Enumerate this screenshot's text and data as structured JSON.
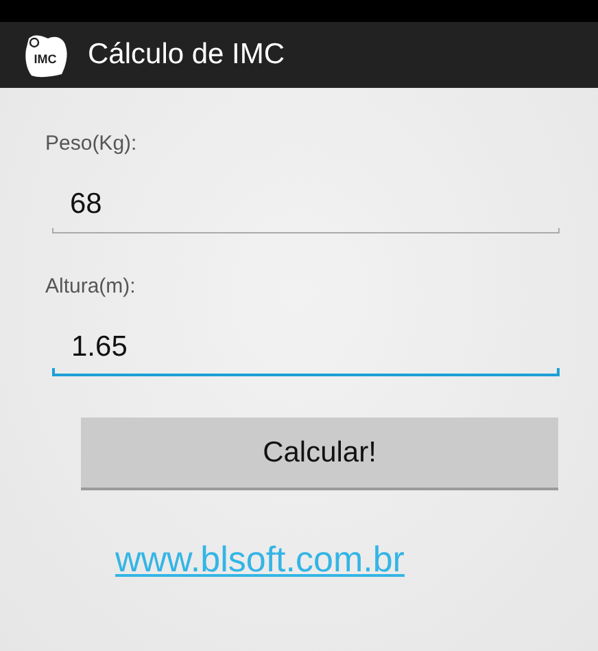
{
  "action_bar": {
    "icon_label": "IMC",
    "title": "Cálculo de IMC"
  },
  "fields": [
    {
      "label": "Peso(Kg):",
      "value": "68",
      "focused": false
    },
    {
      "label": "Altura(m):",
      "value": "1.65",
      "focused": true
    }
  ],
  "button": "Calcular!",
  "link": "www.blsoft.com.br"
}
